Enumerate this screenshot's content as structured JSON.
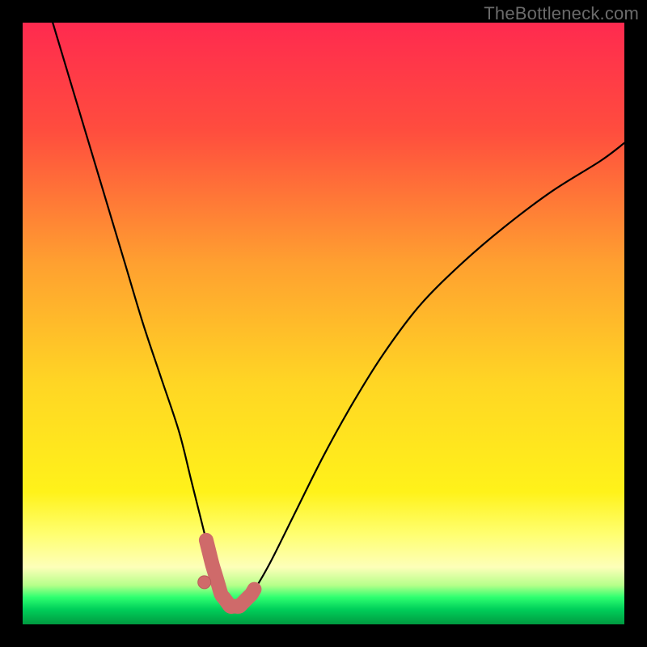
{
  "watermark": "TheBottleneck.com",
  "colors": {
    "frame": "#000000",
    "gradient_stops": [
      {
        "offset": 0.0,
        "color": "#ff2a4f"
      },
      {
        "offset": 0.18,
        "color": "#ff4d3e"
      },
      {
        "offset": 0.4,
        "color": "#ffa030"
      },
      {
        "offset": 0.6,
        "color": "#ffd624"
      },
      {
        "offset": 0.78,
        "color": "#fff21a"
      },
      {
        "offset": 0.85,
        "color": "#ffff70"
      },
      {
        "offset": 0.905,
        "color": "#fdffb9"
      },
      {
        "offset": 0.935,
        "color": "#b6ff8a"
      },
      {
        "offset": 0.955,
        "color": "#2eff70"
      },
      {
        "offset": 0.975,
        "color": "#00cf5a"
      },
      {
        "offset": 1.0,
        "color": "#009a40"
      }
    ],
    "curve": "#000000",
    "bead_fill": "#cf6a6a",
    "bead_stroke": "#b85a5a"
  },
  "chart_data": {
    "type": "line",
    "title": "",
    "xlabel": "",
    "ylabel": "",
    "xlim": [
      0,
      100
    ],
    "ylim": [
      0,
      100
    ],
    "grid": false,
    "legend": false,
    "series": [
      {
        "name": "bottleneck-curve",
        "x": [
          5,
          8,
          11,
          14,
          17,
          20,
          23,
          26,
          28,
          30,
          31.5,
          33,
          34.5,
          36,
          38,
          41,
          45,
          50,
          55,
          60,
          66,
          73,
          80,
          88,
          96,
          100
        ],
        "y": [
          100,
          90,
          80,
          70,
          60,
          50,
          41,
          32,
          24,
          16,
          10,
          5,
          3,
          3,
          5,
          10,
          18,
          28,
          37,
          45,
          53,
          60,
          66,
          72,
          77,
          80
        ]
      }
    ],
    "annotations": {
      "trough_beads": {
        "note": "thick pink segment and dot near curve minimum",
        "x_range": [
          30.5,
          38.5
        ],
        "y_level": 3,
        "dot": {
          "x": 30.2,
          "y": 7
        }
      }
    }
  }
}
